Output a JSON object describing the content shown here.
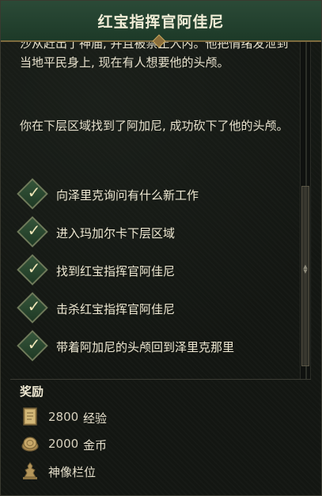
{
  "quest": {
    "title": "红宝指挥官阿佳尼",
    "description": [
      "沙从赶出了神庙, 并且被禁止入内。他把情绪发泄到当地平民身上, 现在有人想要他的头颅。",
      "你在下层区域找到了阿加尼, 成功砍下了他的头颅。"
    ],
    "objectives": [
      {
        "label": "向泽里克询问有什么新工作",
        "completed": true
      },
      {
        "label": "进入玛加尔卡下层区域",
        "completed": true
      },
      {
        "label": "找到红宝指挥官阿佳尼",
        "completed": true
      },
      {
        "label": "击杀红宝指挥官阿佳尼",
        "completed": true
      },
      {
        "label": "带着阿加尼的头颅回到泽里克那里",
        "completed": true
      }
    ]
  },
  "rewards": {
    "title": "奖励",
    "items": [
      {
        "icon": "tome-icon",
        "amount": "2800",
        "label": "经验"
      },
      {
        "icon": "coin-icon",
        "amount": "2000",
        "label": "金币"
      },
      {
        "icon": "statue-icon",
        "amount": "",
        "label": "神像栏位"
      }
    ]
  },
  "colors": {
    "header": "#1d3a28",
    "header_border": "#7e6b3e",
    "check": "#35553a",
    "text": "#e6e0cc"
  }
}
